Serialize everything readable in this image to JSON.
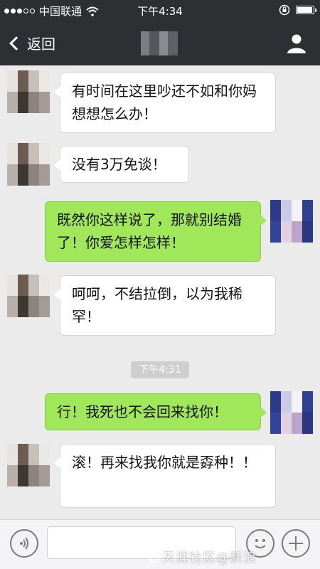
{
  "status_bar": {
    "carrier": "中国联通",
    "time": "下午4:34",
    "signal_dots": 5,
    "signal_filled": 3,
    "wifi_icon": "wifi-icon",
    "rotation_lock_icon": "rotation-lock-icon",
    "battery_icon": "battery-icon",
    "battery_level": 0.95
  },
  "nav": {
    "back_label": "返回",
    "contact_icon": "person-icon"
  },
  "messages": [
    {
      "side": "left",
      "text": "有时间在这里吵还不如和你妈想想怎么办！"
    },
    {
      "side": "left",
      "text": "没有3万免谈！"
    },
    {
      "side": "right",
      "text": "既然你这样说了，那就别结婚了！你爱怎样怎样！"
    },
    {
      "side": "left",
      "text": "呵呵，不结拉倒，以为我稀罕！"
    },
    {
      "side": "timestamp",
      "text": "下午4:31"
    },
    {
      "side": "right",
      "text": "行！我死也不会回来找你！"
    },
    {
      "side": "left",
      "text": "滚！再来找我你就是孬种！！"
    }
  ],
  "input_bar": {
    "voice_icon": "voice-icon",
    "emoji_icon": "emoji-icon",
    "plus_icon": "plus-icon",
    "text_value": ""
  },
  "watermark": "天涯社区@新浪"
}
